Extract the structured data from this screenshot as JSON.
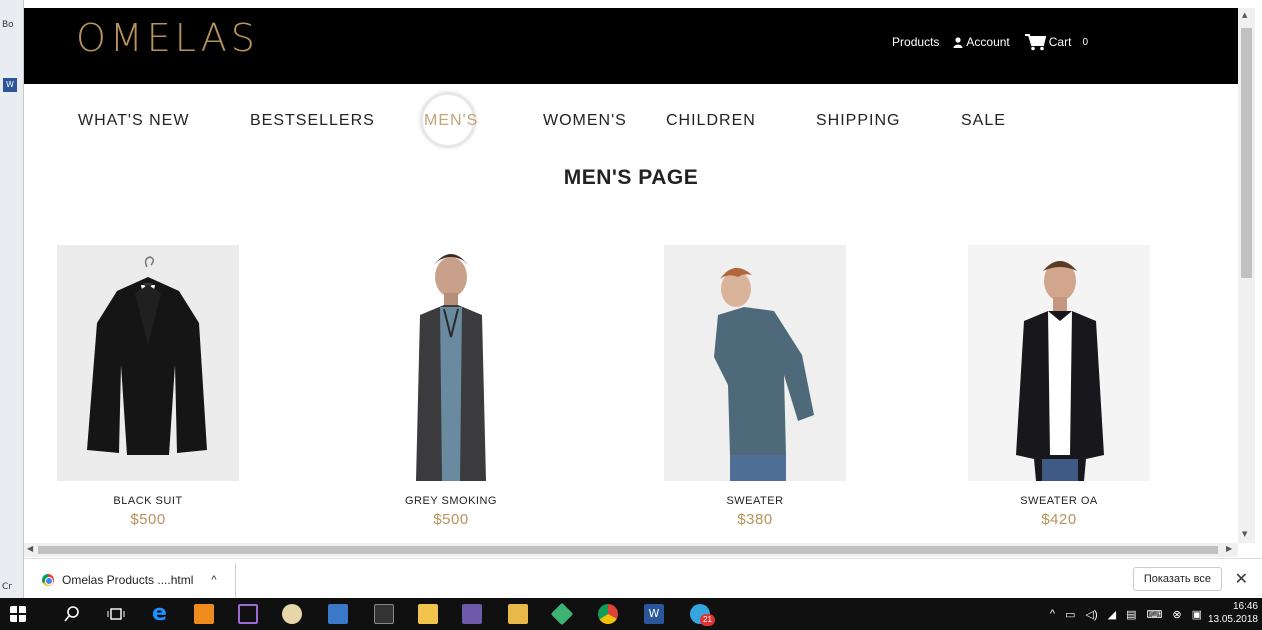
{
  "desktop": {
    "fragment_top": "Bo",
    "fragment_bottom": "Cr"
  },
  "site": {
    "logo": "OMELAS",
    "top_links": {
      "products": "Products",
      "account": "Account",
      "cart": "Cart",
      "cart_count": "0"
    },
    "nav": [
      {
        "label": "WHAT'S NEW"
      },
      {
        "label": "BESTSELLERS"
      },
      {
        "label": "MEN'S",
        "active": true
      },
      {
        "label": "WOMEN'S"
      },
      {
        "label": "CHILDREN"
      },
      {
        "label": "SHIPPING"
      },
      {
        "label": "SALE"
      }
    ],
    "page_title": "MEN'S PAGE",
    "products": [
      {
        "name": "BLACK SUIT",
        "price": "$500"
      },
      {
        "name": "GREY SMOKING",
        "price": "$500"
      },
      {
        "name": "SWEATER",
        "price": "$380"
      },
      {
        "name": "SWEATER OA",
        "price": "$420"
      }
    ]
  },
  "download_bar": {
    "file_name": "Omelas Products ....html",
    "show_all": "Показать все"
  },
  "taskbar": {
    "time": "16:46",
    "date": "13.05.2018",
    "telegram_badge": "21"
  },
  "colors": {
    "accent": "#b8935a",
    "header_bg": "#000000",
    "active_nav": "#c2a47a"
  }
}
